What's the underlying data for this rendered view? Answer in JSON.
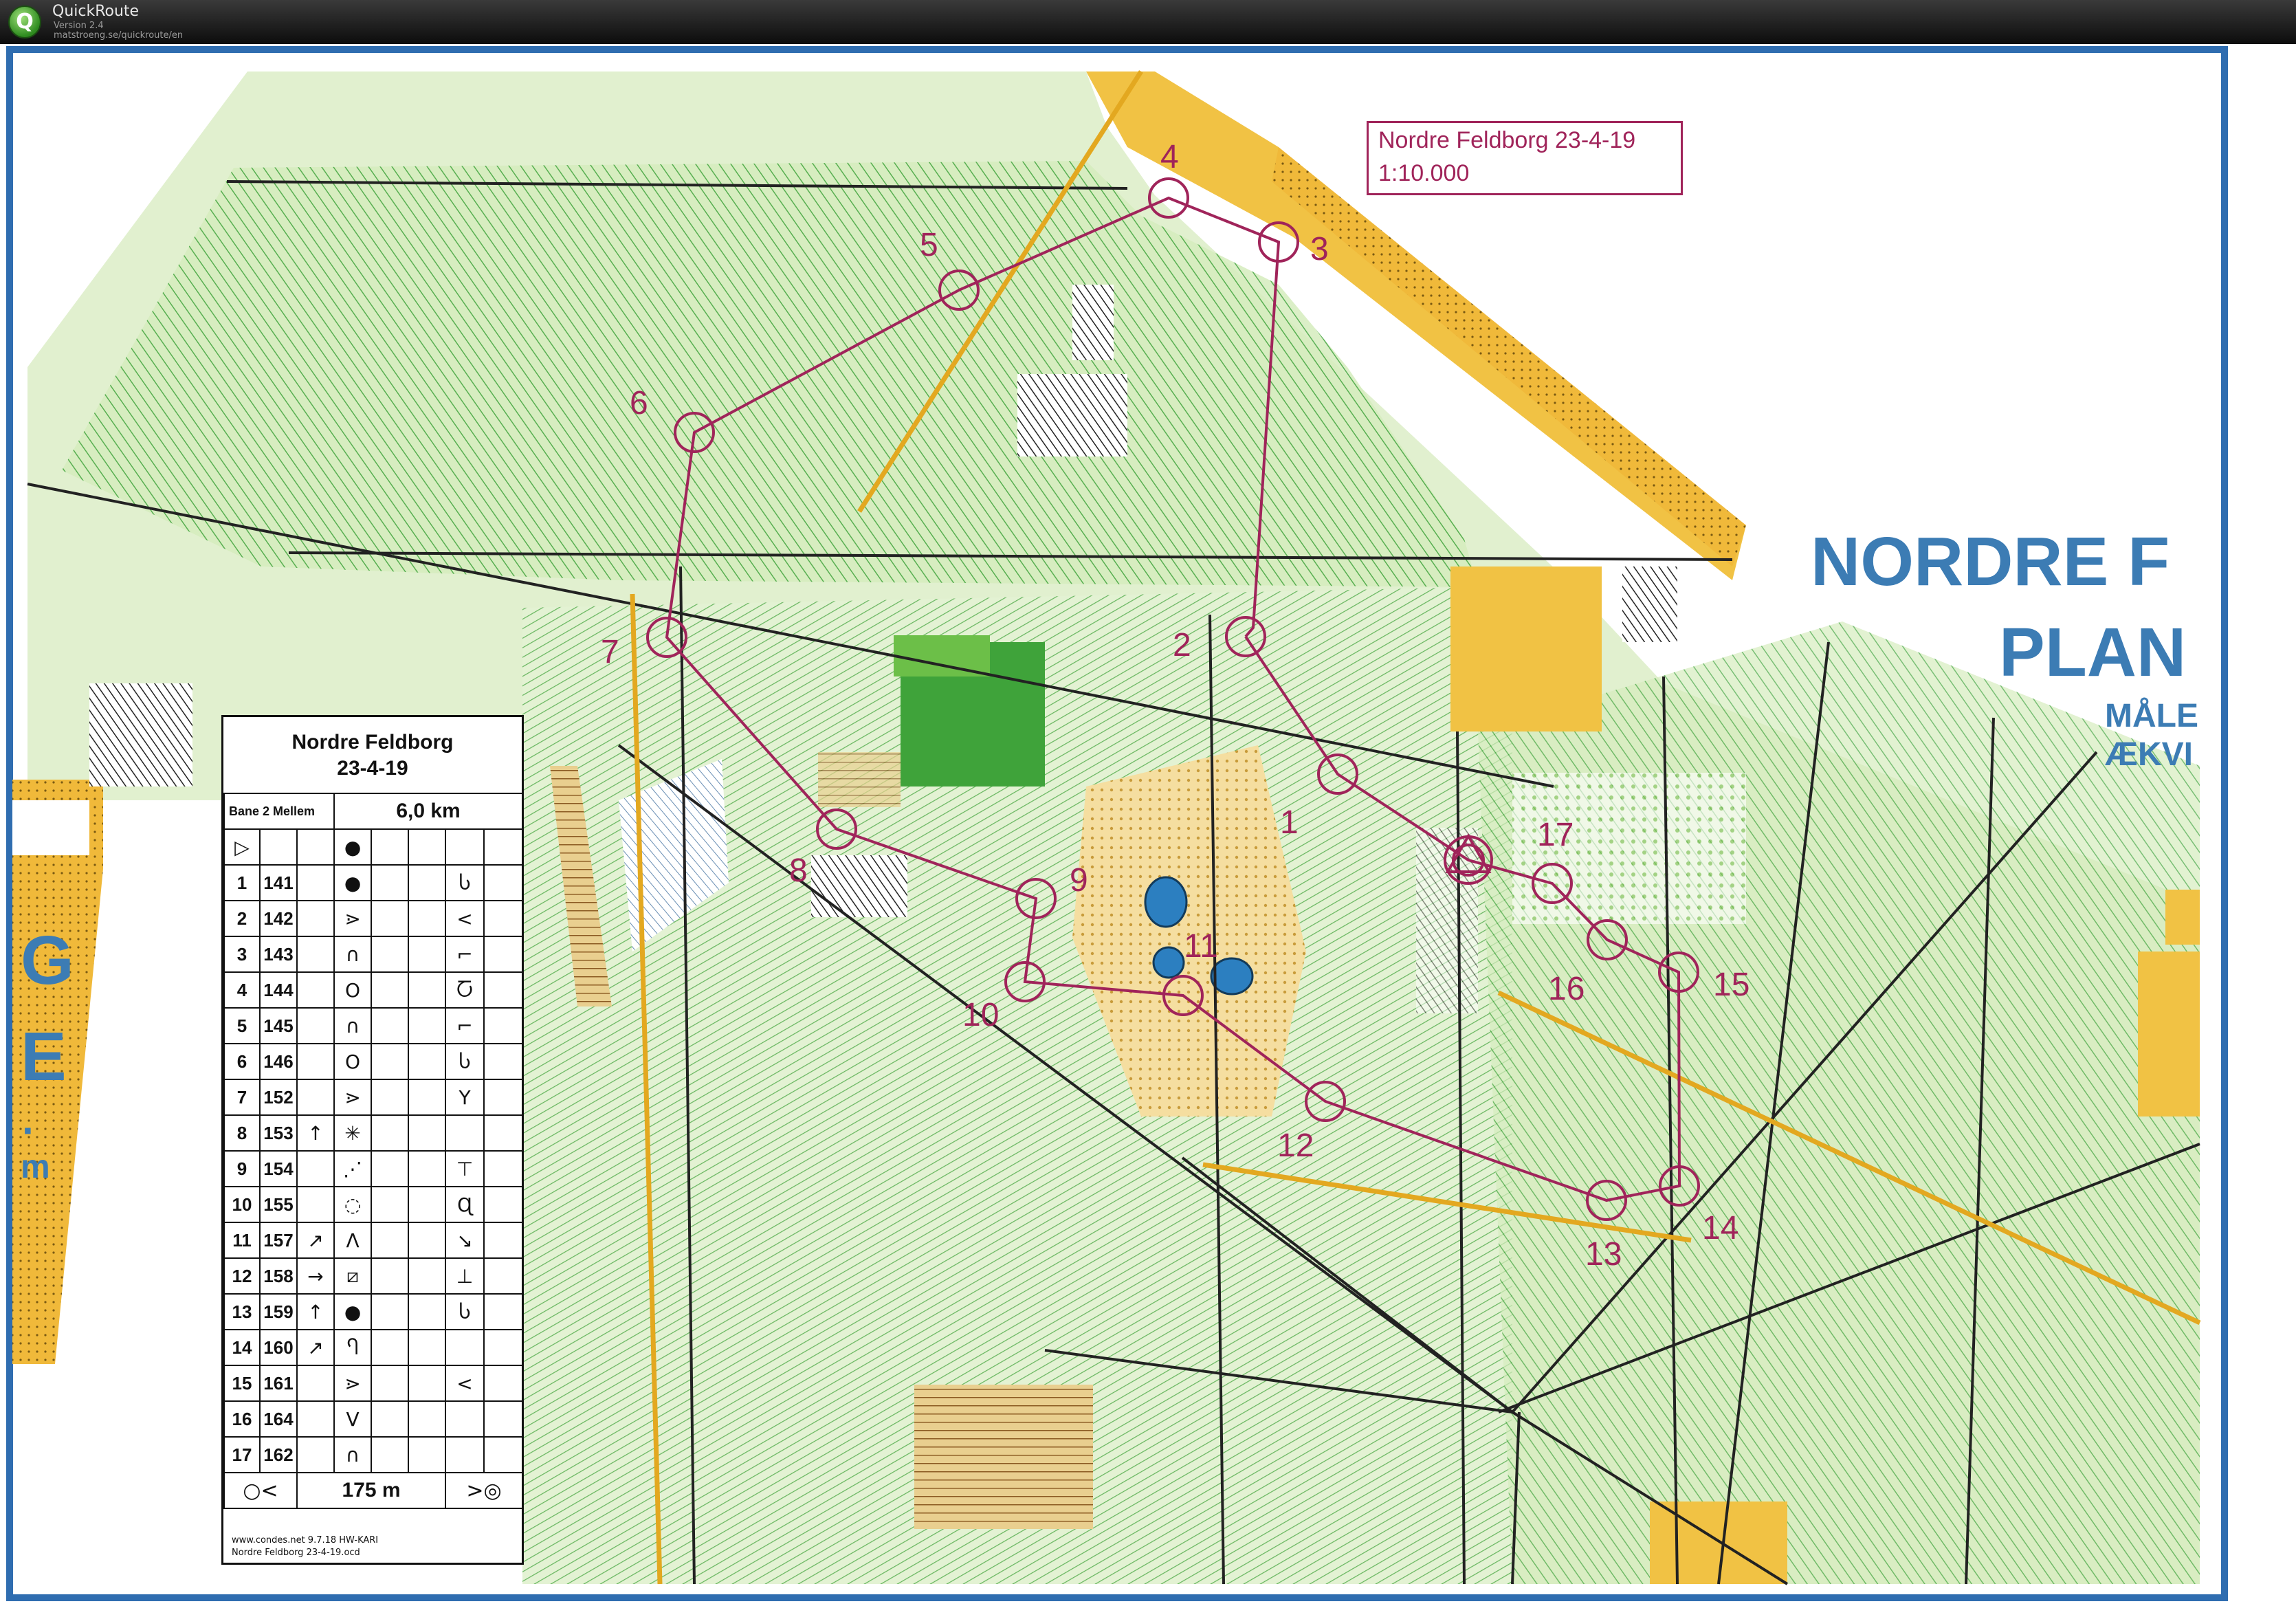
{
  "window": {
    "logo_letter": "Q",
    "app_name": "QuickRoute",
    "version": "Version 2.4",
    "url": "matstroeng.se/quickroute/en"
  },
  "map": {
    "title_box": {
      "name": "Nordre Feldborg 23-4-19",
      "scale": "1:10.000"
    },
    "margin_text": {
      "line1": "NORDRE F",
      "line2": "PLAN",
      "line3": "MÅLE",
      "line4": "ÆKVI",
      "left_g": "G",
      "left_e": "E",
      "left_dot": "·",
      "left_m": "m"
    },
    "colors": {
      "course": "#a0245a",
      "forest_light": "#c8e6a8",
      "forest_mid": "#8fcb6a",
      "forest_dark": "#3fa33a",
      "open_yellow": "#f1c244",
      "open_pale": "#f5dea0",
      "water": "#2c7fc0",
      "border_blue": "#2f6db0",
      "paper": "#ffffff"
    },
    "controls": [
      {
        "num": "1",
        "code": "141"
      },
      {
        "num": "2",
        "code": "142"
      },
      {
        "num": "3",
        "code": "143"
      },
      {
        "num": "4",
        "code": "144"
      },
      {
        "num": "5",
        "code": "145"
      },
      {
        "num": "6",
        "code": "146"
      },
      {
        "num": "7",
        "code": "152"
      },
      {
        "num": "8",
        "code": "153"
      },
      {
        "num": "9",
        "code": "154"
      },
      {
        "num": "10",
        "code": "155"
      },
      {
        "num": "11",
        "code": "157"
      },
      {
        "num": "12",
        "code": "158"
      },
      {
        "num": "13",
        "code": "159"
      },
      {
        "num": "14",
        "code": "160"
      },
      {
        "num": "15",
        "code": "161"
      },
      {
        "num": "16",
        "code": "164"
      },
      {
        "num": "17",
        "code": "162"
      }
    ]
  },
  "descriptions": {
    "event": "Nordre Feldborg",
    "date": "23-4-19",
    "course": "Bane 2 Mellem",
    "length": "6,0 km",
    "start_symbol": "▷",
    "rows": [
      {
        "num": "1",
        "code": "141",
        "dir": "",
        "feature": "●",
        "detail": "",
        "appear": "",
        "pos": "Ⴑ"
      },
      {
        "num": "2",
        "code": "142",
        "dir": "",
        "feature": "⋗",
        "detail": "",
        "appear": "",
        "pos": "<"
      },
      {
        "num": "3",
        "code": "143",
        "dir": "",
        "feature": "∩",
        "detail": "",
        "appear": "",
        "pos": "⌐"
      },
      {
        "num": "4",
        "code": "144",
        "dir": "",
        "feature": "O",
        "detail": "",
        "appear": "",
        "pos": "Ⴀ"
      },
      {
        "num": "5",
        "code": "145",
        "dir": "",
        "feature": "∩",
        "detail": "",
        "appear": "",
        "pos": "⌐"
      },
      {
        "num": "6",
        "code": "146",
        "dir": "",
        "feature": "O",
        "detail": "",
        "appear": "",
        "pos": "Ⴑ"
      },
      {
        "num": "7",
        "code": "152",
        "dir": "",
        "feature": "⋗",
        "detail": "",
        "appear": "",
        "pos": "Y"
      },
      {
        "num": "8",
        "code": "153",
        "dir": "↑",
        "feature": "✳",
        "detail": "",
        "appear": "",
        "pos": ""
      },
      {
        "num": "9",
        "code": "154",
        "dir": "",
        "feature": "⋰",
        "detail": "",
        "appear": "",
        "pos": "⊤"
      },
      {
        "num": "10",
        "code": "155",
        "dir": "",
        "feature": "◌",
        "detail": "",
        "appear": "",
        "pos": "Ɋ"
      },
      {
        "num": "11",
        "code": "157",
        "dir": "↗",
        "feature": "Λ",
        "detail": "",
        "appear": "",
        "pos": "↘"
      },
      {
        "num": "12",
        "code": "158",
        "dir": "→",
        "feature": "⧄",
        "detail": "",
        "appear": "",
        "pos": "⊥"
      },
      {
        "num": "13",
        "code": "159",
        "dir": "↑",
        "feature": "●",
        "detail": "",
        "appear": "",
        "pos": "Ⴑ"
      },
      {
        "num": "14",
        "code": "160",
        "dir": "↗",
        "feature": "Ⴄ",
        "detail": "",
        "appear": "",
        "pos": ""
      },
      {
        "num": "15",
        "code": "161",
        "dir": "",
        "feature": "⋗",
        "detail": "",
        "appear": "",
        "pos": "<"
      },
      {
        "num": "16",
        "code": "164",
        "dir": "",
        "feature": "V",
        "detail": "",
        "appear": "",
        "pos": ""
      },
      {
        "num": "17",
        "code": "162",
        "dir": "",
        "feature": "∩",
        "detail": "",
        "appear": "",
        "pos": ""
      }
    ],
    "finish_left": "○<",
    "finish_distance": "175 m",
    "finish_right": ">◎",
    "footer_software": "www.condes.net 9.7.18 HW-KARI",
    "footer_file": "Nordre Feldborg 23-4-19.ocd"
  }
}
